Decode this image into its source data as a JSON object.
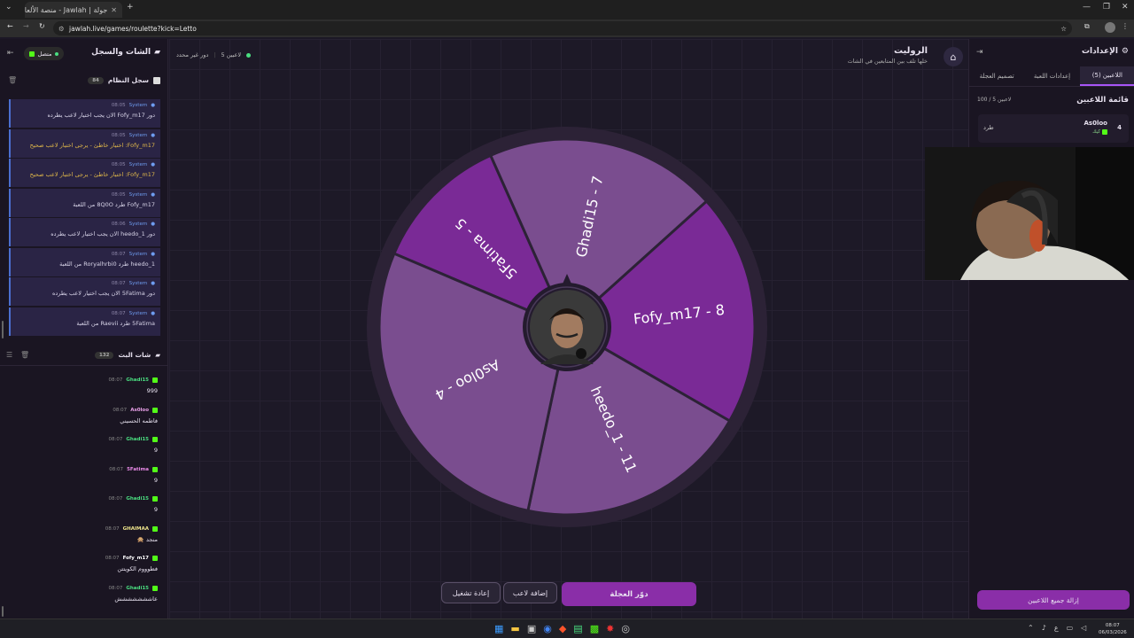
{
  "browser": {
    "tab_title": "جولة | Jawlah - منصة الألعاب ال...",
    "url": "jawlah.live/games/roulette?kick=Letto"
  },
  "left": {
    "title": "الشات والسجل",
    "status": "متصل",
    "syslog_title": "سجل النظام",
    "syslog_count": "84",
    "system_messages": [
      {
        "time": "08:05",
        "name": "System",
        "text": "دور Fofy_m17 الان يجب اختيار لاعب يطرده",
        "warn": false
      },
      {
        "time": "08:05",
        "name": "System",
        "text": "Fofy_m17: اختيار خاطئ - يرجى اختيار لاعب صحيح",
        "warn": true
      },
      {
        "time": "08:05",
        "name": "System",
        "text": "Fofy_m17: اختيار خاطئ - يرجى اختيار لاعب صحيح",
        "warn": true
      },
      {
        "time": "08:05",
        "name": "System",
        "text": "Fofy_m17 طرد 8Q0O من اللعبة",
        "warn": false
      },
      {
        "time": "08:06",
        "name": "System",
        "text": "دور heedo_1 الان يجب اختيار لاعب يطرده",
        "warn": false
      },
      {
        "time": "08:07",
        "name": "System",
        "text": "heedo_1 طرد Roryalhrbi0 من اللعبة",
        "warn": false
      },
      {
        "time": "08:07",
        "name": "System",
        "text": "دور 5Fatima الان يجب اختيار لاعب يطرده",
        "warn": false
      },
      {
        "time": "08:07",
        "name": "System",
        "text": "5Fatima طرد Raevii من اللعبة",
        "warn": false
      }
    ],
    "chat_title": "شات البث",
    "chat_count": "132",
    "chat_messages": [
      {
        "time": "08:07",
        "user": "Ghadi15",
        "color": "#4ade80",
        "text": "999"
      },
      {
        "time": "08:07",
        "user": "As0loo",
        "color": "#e8a0e8",
        "text": "فاطمه الحسيني"
      },
      {
        "time": "08:07",
        "user": "Ghadi15",
        "color": "#4ade80",
        "text": "9"
      },
      {
        "time": "08:07",
        "user": "5Fatima",
        "color": "#e98ae8",
        "text": "9"
      },
      {
        "time": "08:07",
        "user": "Ghadi15",
        "color": "#4ade80",
        "text": "9"
      },
      {
        "time": "08:07",
        "user": "GHAIMAA",
        "color": "#f0e68c",
        "text": "منجد 🙊"
      },
      {
        "time": "08:07",
        "user": "Fofy_m17",
        "color": "#ffffff",
        "text": "فطوووم الكويتتن"
      },
      {
        "time": "08:07",
        "user": "Ghadi15",
        "color": "#4ade80",
        "text": "عاششششششش"
      }
    ]
  },
  "center": {
    "title": "الروليت",
    "subtitle": "خلها تلف بين المتابعين في الشات",
    "players_label": "5 لاعبين",
    "round_label": "دور غير محدد",
    "segments": [
      {
        "label": "5Fatima - 5",
        "color": "#7a2a96"
      },
      {
        "label": "Ghadi15 - 7",
        "color": "#7a4d8f"
      },
      {
        "label": "Fofy_m17 - 8",
        "color": "#7a2a96"
      },
      {
        "label": "heedo_1 - 11",
        "color": "#7a4d8f"
      },
      {
        "label": "As0loo - 4",
        "color": "#7a4d8f"
      }
    ],
    "spin": "دوّر العجلة",
    "add_player": "إضافة لاعب",
    "restart": "إعادة تشغيل"
  },
  "right": {
    "title": "الإعدادات",
    "tabs": [
      "اللاعبين (5)",
      "إعدادات اللعبة",
      "تصميم العجلة"
    ],
    "list_title": "قائمة اللاعبين",
    "limit": "100 / 5 لاعبين",
    "player": {
      "index": "4",
      "name": "As0loo",
      "platform": "كيك",
      "kick_label": "طرد"
    },
    "remove_all": "إزالة جميع اللاعبين"
  },
  "taskbar": {
    "time": "08:07",
    "date": "06/03/2026",
    "lang": "ع"
  }
}
